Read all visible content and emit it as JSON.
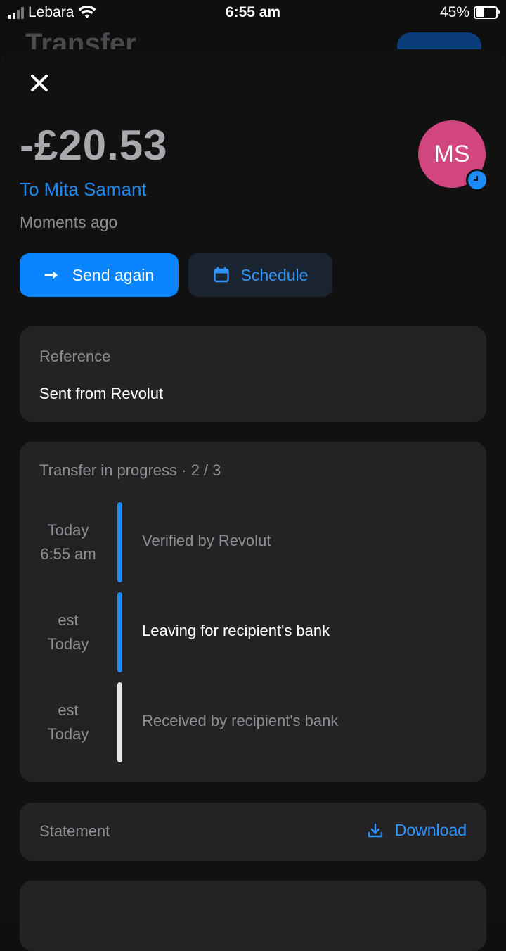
{
  "status_bar": {
    "carrier": "Lebara",
    "time": "6:55 am",
    "battery": "45%",
    "battery_level": 0.45
  },
  "background": {
    "title_partial": "Transfer"
  },
  "transaction": {
    "amount": "-£20.53",
    "recipient": "To Mita Samant",
    "time_ago": "Moments ago",
    "avatar_initials": "MS"
  },
  "actions": {
    "send_again": "Send again",
    "schedule": "Schedule"
  },
  "reference": {
    "label": "Reference",
    "value": "Sent from Revolut"
  },
  "progress": {
    "title": "Transfer in progress · 2 / 3",
    "steps": [
      {
        "when_line1": "Today",
        "when_line2": "6:55 am",
        "label": "Verified by Revolut",
        "state": "done"
      },
      {
        "when_line1": "est",
        "when_line2": "Today",
        "label": "Leaving for recipient's bank",
        "state": "current"
      },
      {
        "when_line1": "est",
        "when_line2": "Today",
        "label": "Received by recipient's bank",
        "state": "pending"
      }
    ]
  },
  "statement": {
    "label": "Statement",
    "download": "Download"
  },
  "colors": {
    "accent": "#0b84ff",
    "avatar": "#d2467f",
    "card": "#232325"
  }
}
